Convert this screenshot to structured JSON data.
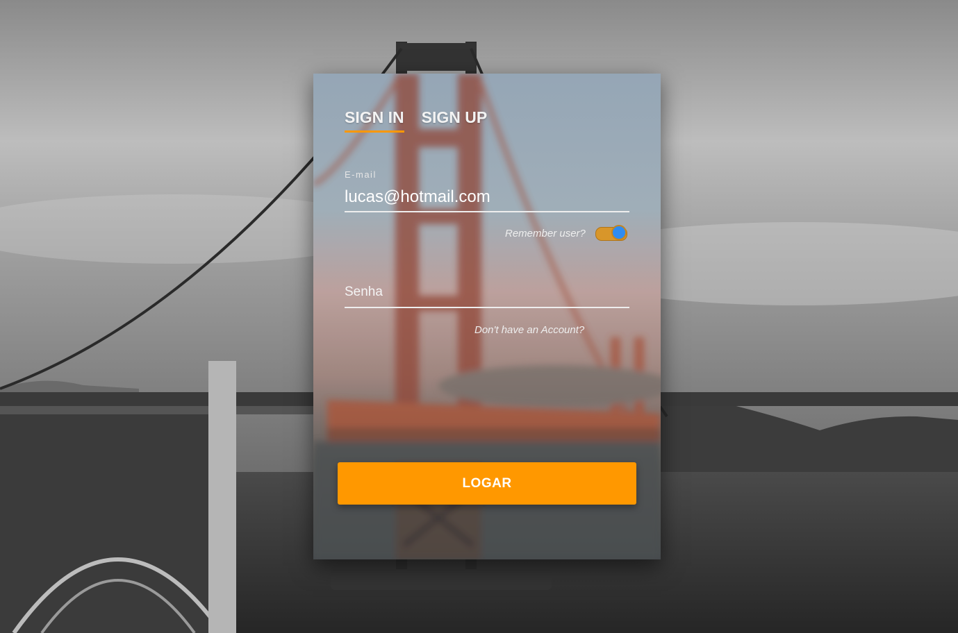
{
  "tabs": {
    "sign_in": "SIGN IN",
    "sign_up": "SIGN UP",
    "active": "sign_in"
  },
  "email": {
    "label": "E-mail",
    "value": "lucas@hotmail.com"
  },
  "remember": {
    "label": "Remember user?",
    "checked": true
  },
  "password": {
    "placeholder": "Senha",
    "value": ""
  },
  "no_account_link": "Don't have an Account?",
  "submit_label": "LOGAR",
  "colors": {
    "accent": "#ff9800",
    "toggle_knob": "#2f8cf0",
    "text": "#ffffff"
  },
  "icons": {
    "background": "golden-gate-bridge-photo"
  }
}
